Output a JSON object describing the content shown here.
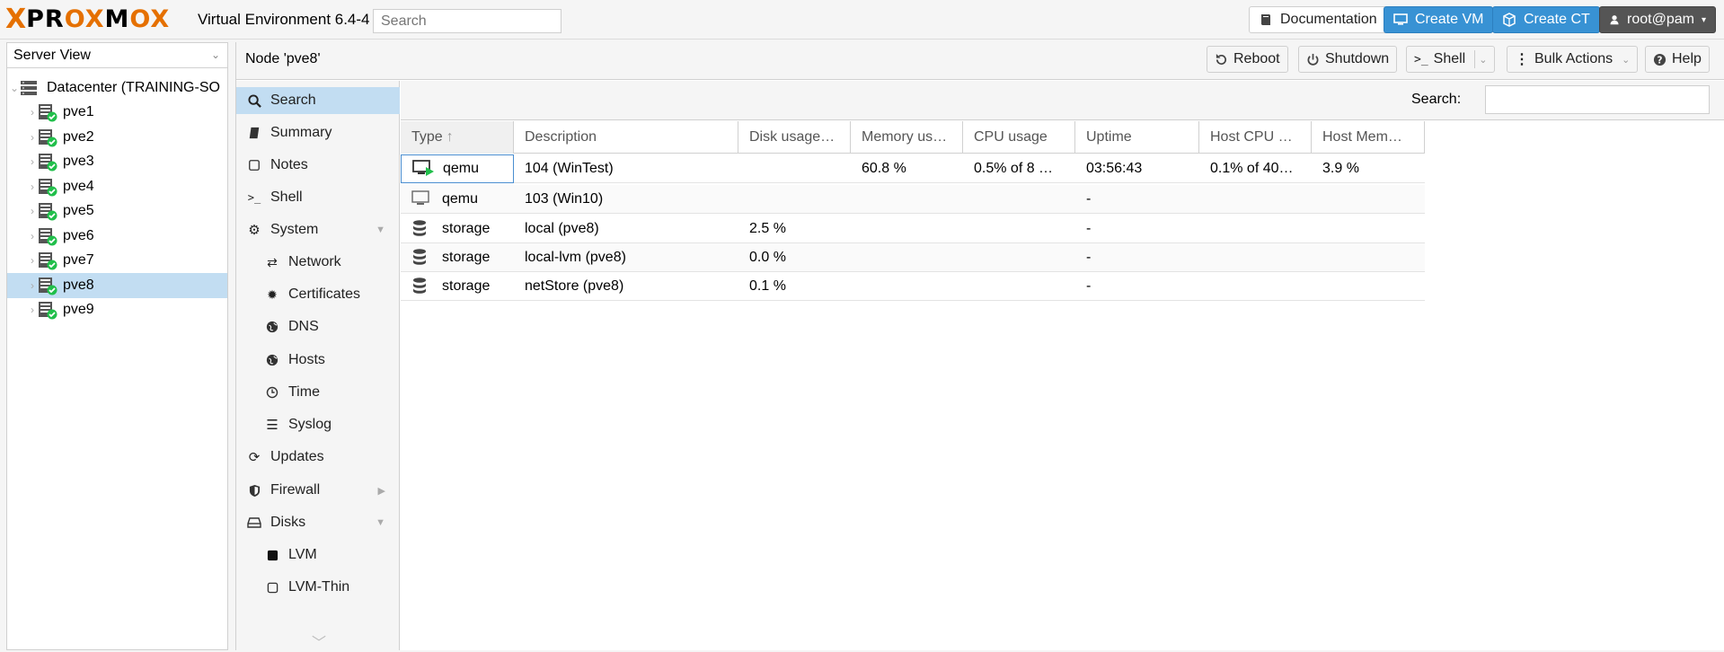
{
  "header": {
    "logo_x": "X",
    "logo_text_a": "PR",
    "logo_text_ox1": "OX",
    "logo_text_m": "M",
    "logo_text_ox2": "OX",
    "version": "Virtual Environment 6.4-4",
    "search_placeholder": "Search",
    "buttons": {
      "documentation": "Documentation",
      "create_vm": "Create VM",
      "create_ct": "Create CT",
      "user": "root@pam"
    }
  },
  "left": {
    "view": "Server View",
    "datacenter": "Datacenter (TRAINING-SO",
    "nodes": [
      "pve1",
      "pve2",
      "pve3",
      "pve4",
      "pve5",
      "pve6",
      "pve7",
      "pve8",
      "pve9"
    ],
    "selected": "pve8"
  },
  "node": {
    "title": "Node 'pve8'",
    "buttons": {
      "reboot": "Reboot",
      "shutdown": "Shutdown",
      "shell": "Shell",
      "bulk": "Bulk Actions",
      "help": "Help"
    }
  },
  "menu": {
    "items": [
      {
        "label": "Search",
        "icon": "search-icon",
        "active": true
      },
      {
        "label": "Summary",
        "icon": "book-icon"
      },
      {
        "label": "Notes",
        "icon": "note-icon"
      },
      {
        "label": "Shell",
        "icon": "terminal-icon"
      },
      {
        "label": "System",
        "icon": "gears-icon",
        "expanded": true
      },
      {
        "label": "Network",
        "icon": "exchange-icon",
        "sub": true
      },
      {
        "label": "Certificates",
        "icon": "certificate-icon",
        "sub": true
      },
      {
        "label": "DNS",
        "icon": "globe-icon",
        "sub": true
      },
      {
        "label": "Hosts",
        "icon": "globe-icon",
        "sub": true
      },
      {
        "label": "Time",
        "icon": "clock-icon",
        "sub": true
      },
      {
        "label": "Syslog",
        "icon": "list-icon",
        "sub": true
      },
      {
        "label": "Updates",
        "icon": "refresh-icon"
      },
      {
        "label": "Firewall",
        "icon": "shield-icon",
        "collapsed": true
      },
      {
        "label": "Disks",
        "icon": "hdd-icon",
        "expanded": true
      },
      {
        "label": "LVM",
        "icon": "square-icon",
        "sub": true
      },
      {
        "label": "LVM-Thin",
        "icon": "square-outline-icon",
        "sub": true
      }
    ]
  },
  "grid": {
    "search_label": "Search:",
    "columns": [
      "Type",
      "Description",
      "Disk usage…",
      "Memory us…",
      "CPU usage",
      "Uptime",
      "Host CPU …",
      "Host Mem…"
    ],
    "rows": [
      {
        "icon": "vm-running-icon",
        "type": "qemu",
        "description": "104 (WinTest)",
        "disk": "",
        "memory": "60.8 %",
        "cpu": "0.5% of 8 …",
        "uptime": "03:56:43",
        "host_cpu": "0.1% of 40…",
        "host_mem": "3.9 %"
      },
      {
        "icon": "vm-stopped-icon",
        "type": "qemu",
        "description": "103 (Win10)",
        "disk": "",
        "memory": "",
        "cpu": "",
        "uptime": "-",
        "host_cpu": "",
        "host_mem": ""
      },
      {
        "icon": "database-icon",
        "type": "storage",
        "description": "local (pve8)",
        "disk": "2.5 %",
        "memory": "",
        "cpu": "",
        "uptime": "-",
        "host_cpu": "",
        "host_mem": ""
      },
      {
        "icon": "database-icon",
        "type": "storage",
        "description": "local-lvm (pve8)",
        "disk": "0.0 %",
        "memory": "",
        "cpu": "",
        "uptime": "-",
        "host_cpu": "",
        "host_mem": ""
      },
      {
        "icon": "database-icon",
        "type": "storage",
        "description": "netStore (pve8)",
        "disk": "0.1 %",
        "memory": "",
        "cpu": "",
        "uptime": "-",
        "host_cpu": "",
        "host_mem": ""
      }
    ]
  }
}
